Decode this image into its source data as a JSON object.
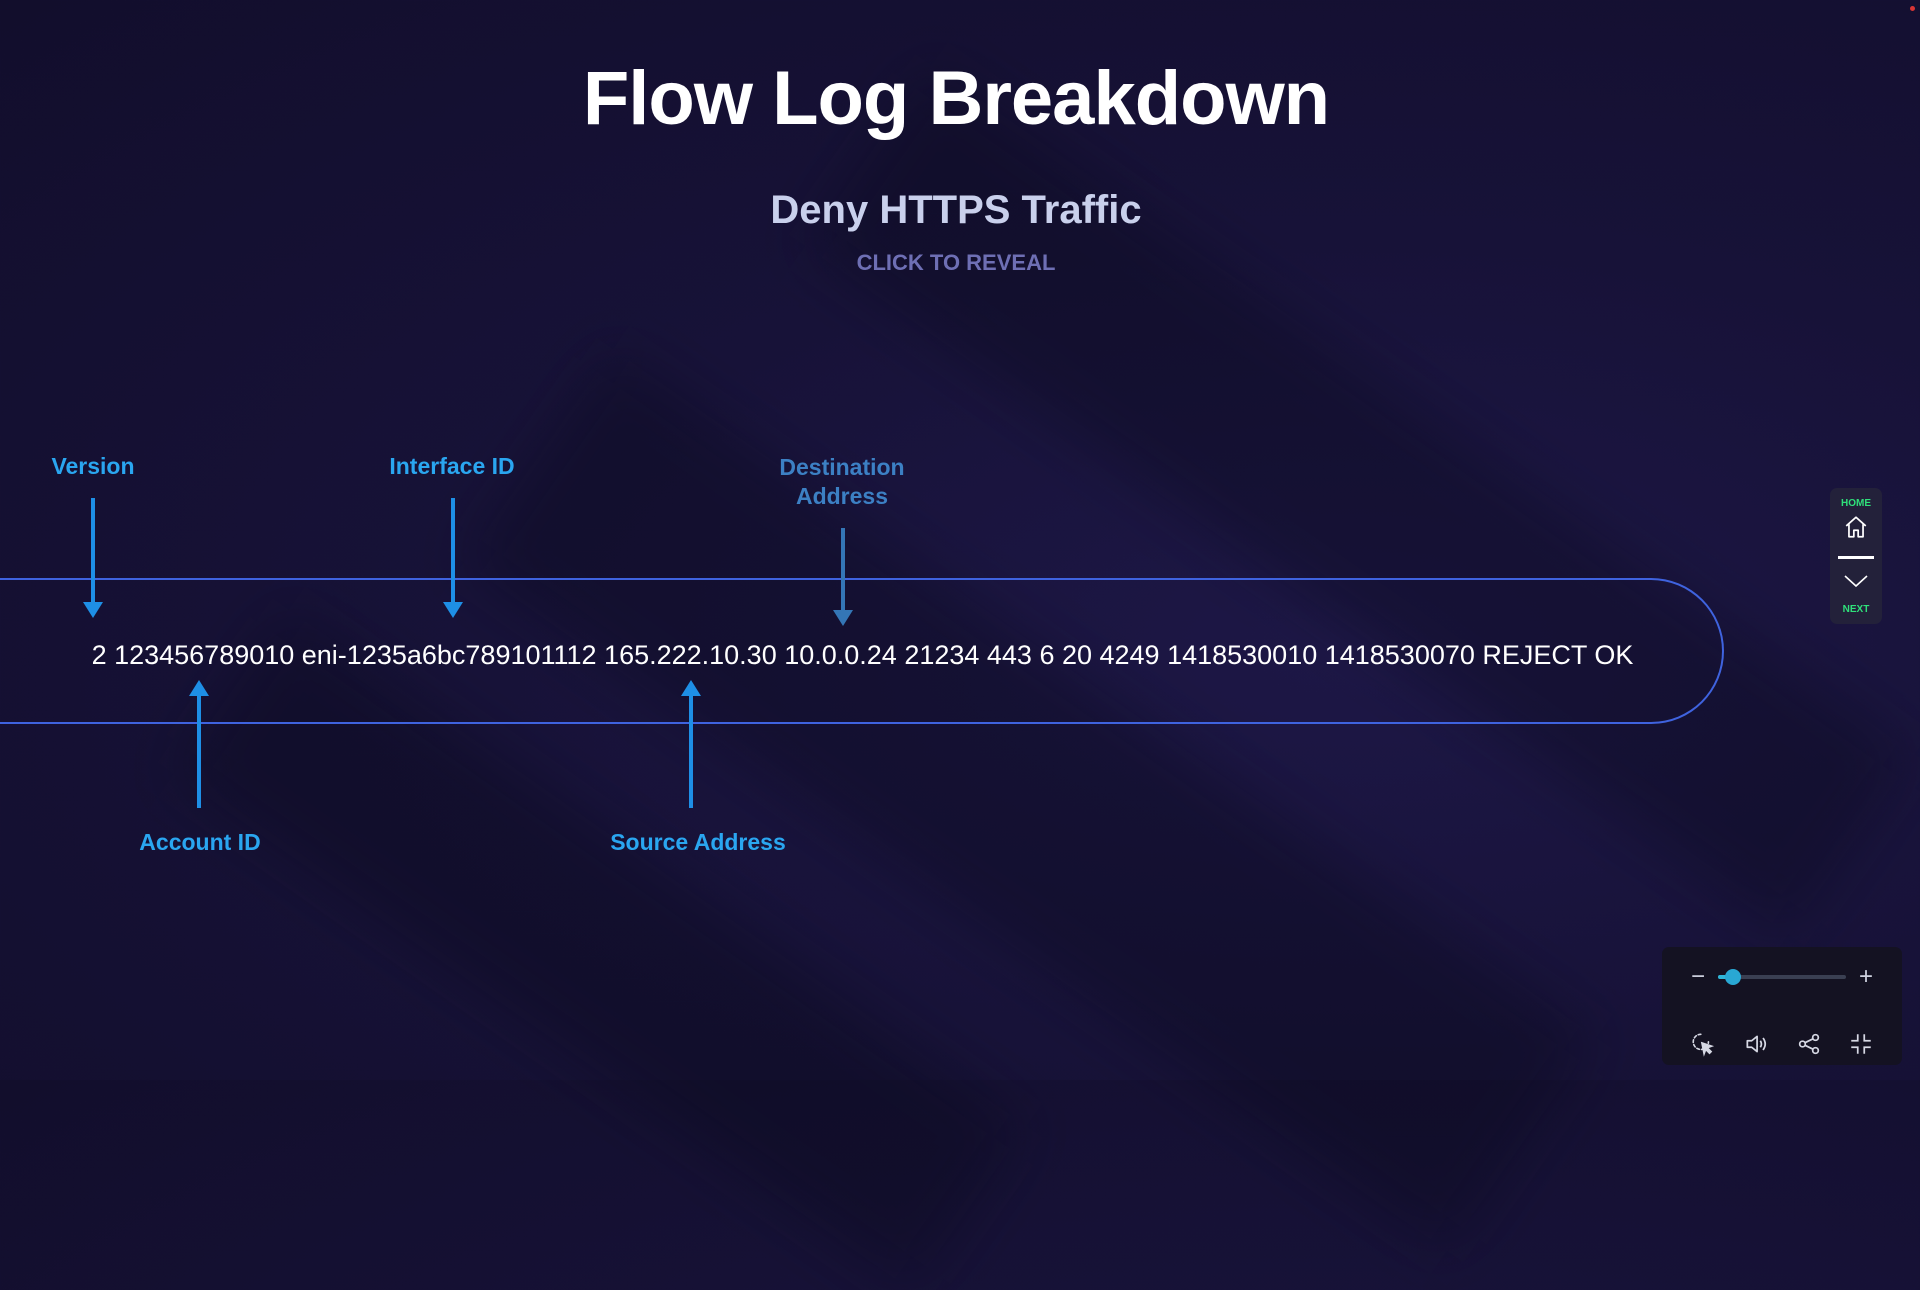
{
  "slide": {
    "title": "Flow Log Breakdown",
    "subtitle": "Deny HTTPS Traffic",
    "reveal_prompt": "CLICK TO REVEAL",
    "log_line": "2 123456789010 eni-1235a6bc789101112 165.222.10.30 10.0.0.24 21234 443 6 20 4249 1418530010 1418530070 REJECT OK"
  },
  "labels": {
    "version": "Version",
    "interface_id": "Interface ID",
    "destination_line1": "Destination",
    "destination_line2": "Address",
    "account_id": "Account ID",
    "source_address": "Source Address"
  },
  "side_nav": {
    "home_label": "HOME",
    "next_label": "NEXT",
    "label_color": "#2fe07a"
  },
  "player_controls": {
    "zoom_out": "−",
    "zoom_in": "+",
    "zoom_level_fraction": 0.12,
    "icons": [
      "cursor-click-icon",
      "volume-icon",
      "share-icon",
      "exit-fullscreen-icon"
    ],
    "accent_color": "#2fb6d8"
  },
  "colors": {
    "label_bright": "#2aa6f0",
    "band_border": "#3f63df",
    "background": "#171238"
  }
}
